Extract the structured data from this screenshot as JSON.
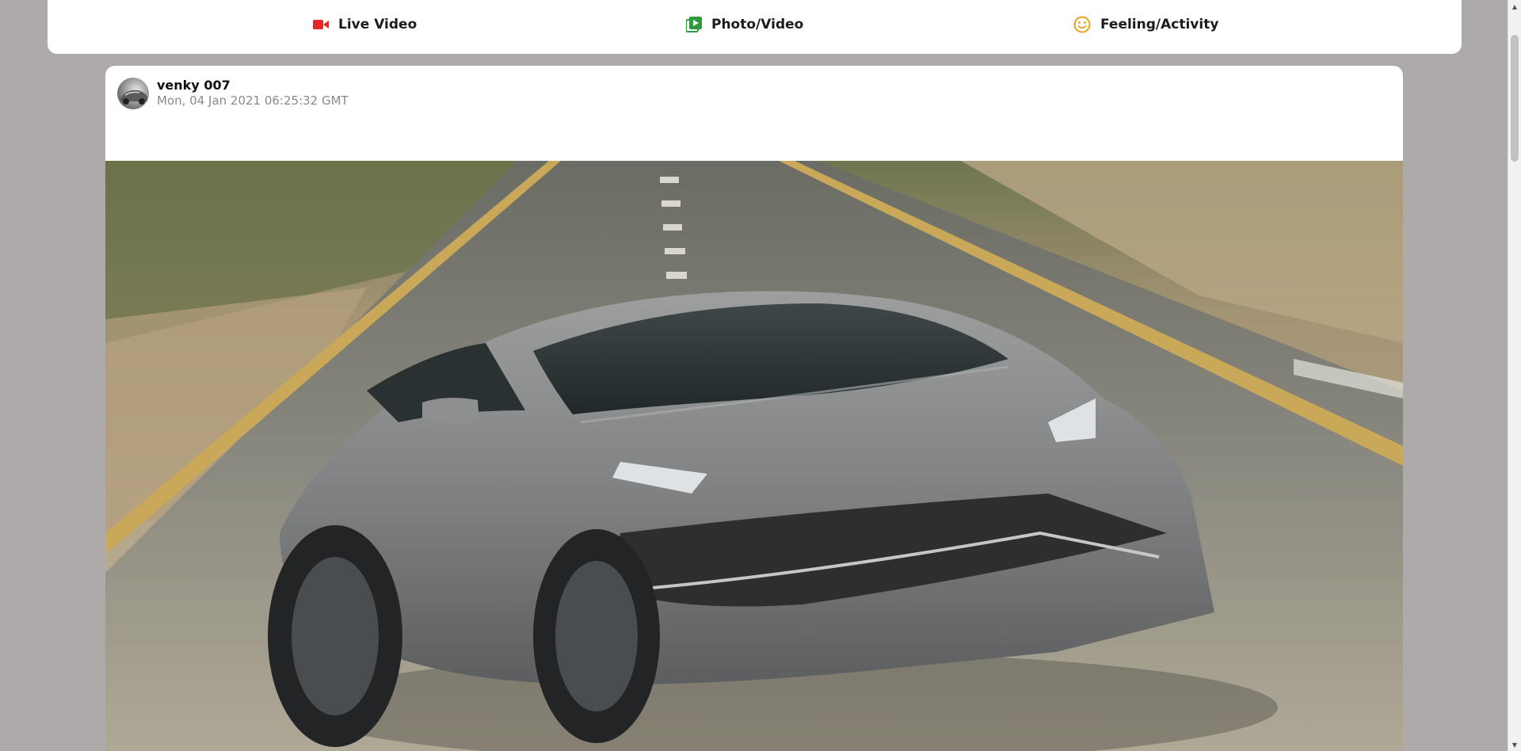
{
  "composer": {
    "actions": [
      {
        "label": "Live Video",
        "icon": "video-camera-icon",
        "color": "#e42727"
      },
      {
        "label": "Photo/Video",
        "icon": "photo-video-icon",
        "color": "#2e9a3d"
      },
      {
        "label": "Feeling/Activity",
        "icon": "smiley-icon",
        "color": "#e8a21c"
      }
    ]
  },
  "post": {
    "author": "venky 007",
    "timestamp": "Mon, 04 Jan 2021 06:25:32 GMT",
    "avatar_icon": "user-avatar",
    "media": "photo of a grey sports car driving on a road"
  },
  "colors": {
    "page_background": "#aeaaaa",
    "card_background": "#ffffff"
  }
}
